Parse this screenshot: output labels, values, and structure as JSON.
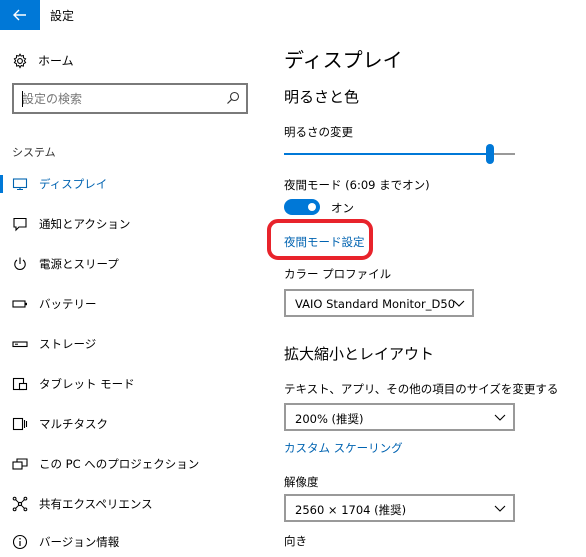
{
  "titlebar": {
    "back_icon": "back-arrow-icon",
    "title": "設定"
  },
  "sidebar": {
    "home": {
      "label": "ホーム",
      "icon": "gear-icon"
    },
    "search": {
      "placeholder": "設定の検索",
      "icon": "search-icon"
    },
    "section_label": "システム",
    "items": [
      {
        "label": "ディスプレイ",
        "icon": "monitor-icon",
        "active": true
      },
      {
        "label": "通知とアクション",
        "icon": "notification-icon",
        "active": false
      },
      {
        "label": "電源とスリープ",
        "icon": "power-icon",
        "active": false
      },
      {
        "label": "バッテリー",
        "icon": "battery-icon",
        "active": false
      },
      {
        "label": "ストレージ",
        "icon": "storage-icon",
        "active": false
      },
      {
        "label": "タブレット モード",
        "icon": "tablet-mode-icon",
        "active": false
      },
      {
        "label": "マルチタスク",
        "icon": "multitasking-icon",
        "active": false
      },
      {
        "label": "この PC へのプロジェクション",
        "icon": "projection-icon",
        "active": false
      },
      {
        "label": "共有エクスペリエンス",
        "icon": "shared-experiences-icon",
        "active": false
      },
      {
        "label": "バージョン情報",
        "icon": "info-icon",
        "active": false
      }
    ]
  },
  "main": {
    "title": "ディスプレイ",
    "brightness": {
      "heading": "明るさと色",
      "slider_label": "明るさの変更",
      "slider_value": 0.89
    },
    "night_light": {
      "label": "夜間モード (6:09 までオン)",
      "toggle_state": "オン",
      "settings_link": "夜間モード設定"
    },
    "color_profile": {
      "label": "カラー プロファイル",
      "value": "VAIO Standard Monitor_D50"
    },
    "scale_layout": {
      "heading": "拡大縮小とレイアウト",
      "size_label": "テキスト、アプリ、その他の項目のサイズを変更する",
      "size_value": "200% (推奨)",
      "custom_link": "カスタム スケーリング",
      "resolution_label": "解像度",
      "resolution_value": "2560 × 1704 (推奨)",
      "orientation_label": "向き"
    }
  },
  "colors": {
    "accent": "#0078d7",
    "link": "#0063b1",
    "highlight_ring": "#e8232b"
  }
}
